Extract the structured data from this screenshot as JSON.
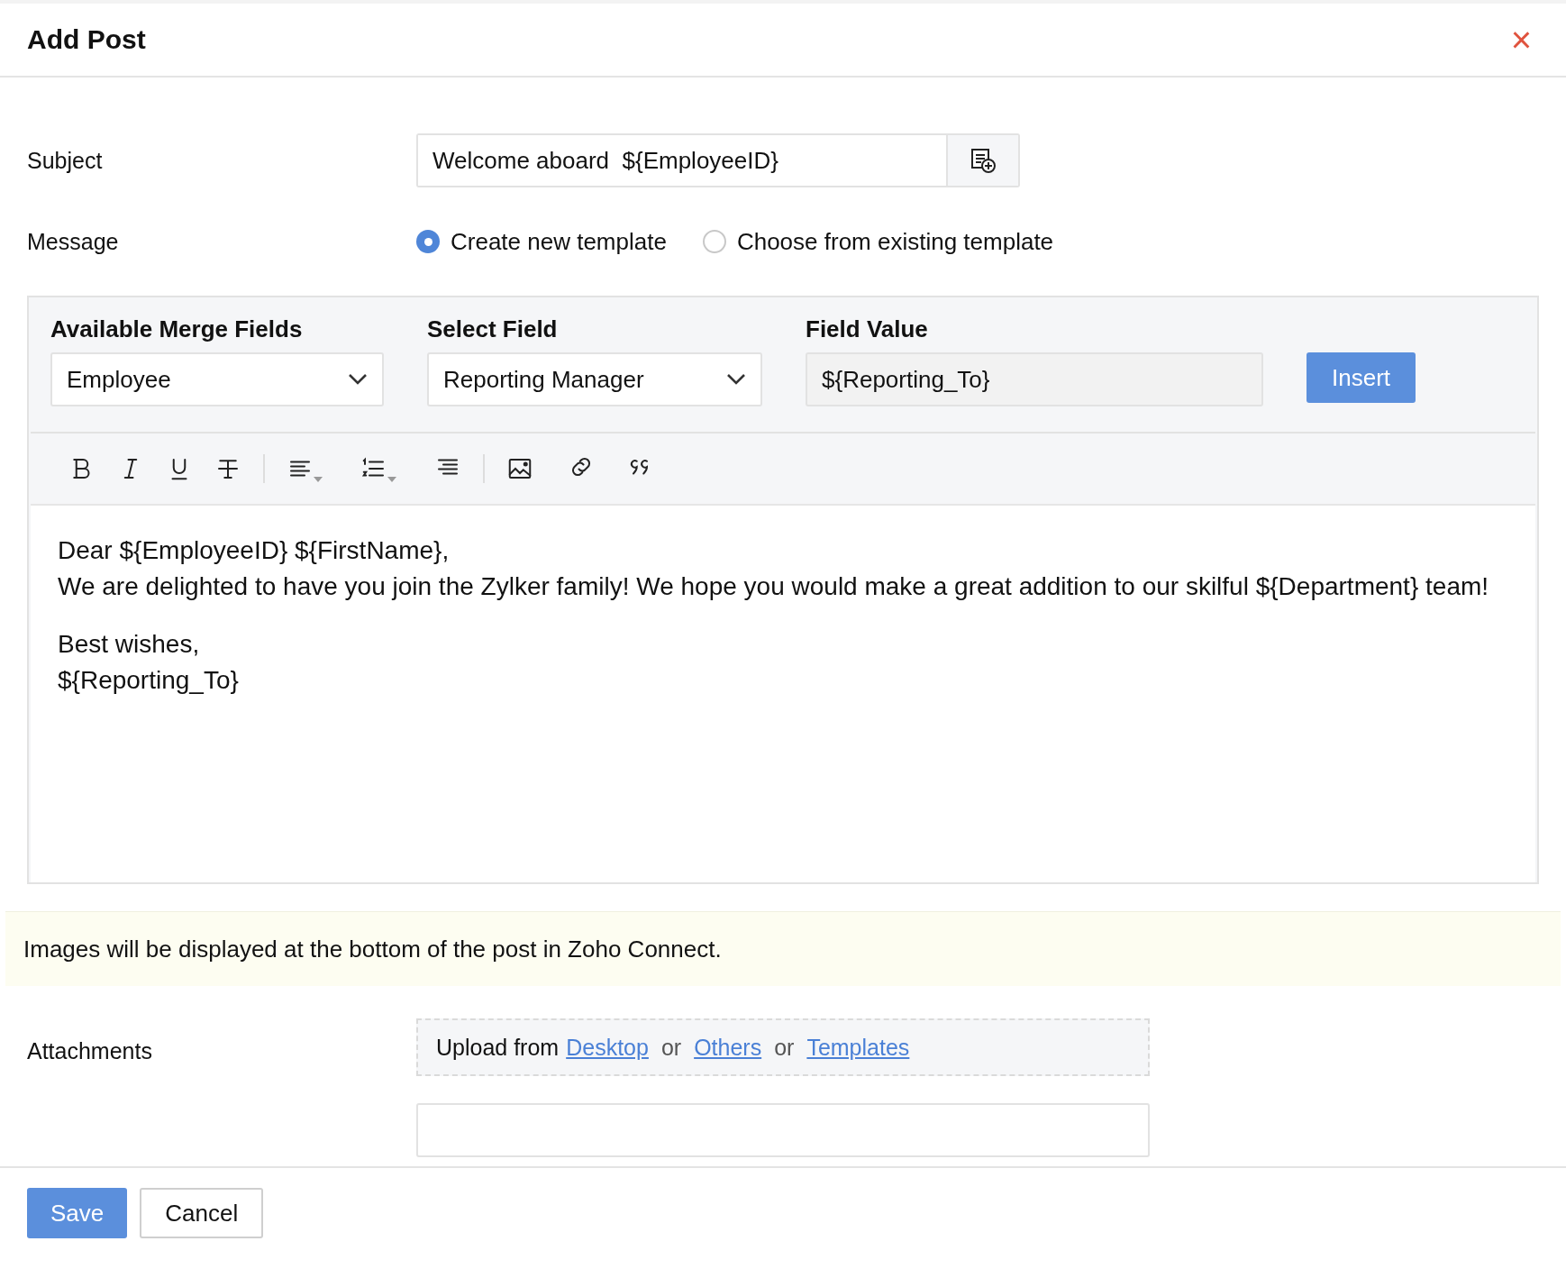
{
  "dialog": {
    "title": "Add Post",
    "close": "×"
  },
  "subject": {
    "label": "Subject",
    "value": "Welcome aboard  ${EmployeeID}"
  },
  "message": {
    "label": "Message",
    "options": [
      {
        "label": "Create new template",
        "selected": true
      },
      {
        "label": "Choose from existing template",
        "selected": false
      }
    ]
  },
  "merge_fields": {
    "available_label": "Available Merge Fields",
    "available_value": "Employee",
    "select_label": "Select Field",
    "select_value": "Reporting Manager",
    "value_label": "Field Value",
    "value": "${Reporting_To}",
    "insert": "Insert"
  },
  "editor": {
    "paragraphs": [
      [
        "Dear ${EmployeeID} ${FirstName},",
        "We are delighted to have you join the Zylker family! We hope you would make a great addition to our skilful ${Department} team!"
      ],
      [
        "Best wishes,",
        "${Reporting_To}"
      ]
    ]
  },
  "notice": "Images will be displayed at the bottom of the post in Zoho Connect.",
  "attachments": {
    "label": "Attachments",
    "prefix": "Upload from",
    "links": [
      "Desktop",
      "Others",
      "Templates"
    ],
    "separators": [
      "or",
      "or"
    ]
  },
  "buttons": {
    "save": "Save",
    "cancel": "Cancel"
  }
}
